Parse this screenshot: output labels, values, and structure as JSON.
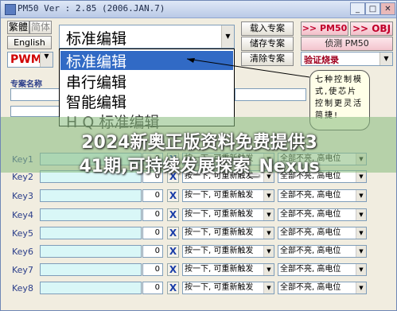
{
  "window": {
    "title": "PM50 Ver : 2.85 (2006.JAN.7)"
  },
  "titlebar": {
    "minimize": "_",
    "maximize": "□",
    "close": "✕"
  },
  "left": {
    "lang_cn1": "繁體",
    "lang_cn2": "简体",
    "lang_en": "English",
    "mode_value": "PWM"
  },
  "editor_mode": {
    "selected": "标准编辑",
    "options": [
      "标准编辑",
      "串行编辑",
      "智能编辑",
      "H Q 标准编辑"
    ]
  },
  "buttons": {
    "load": "载入专案",
    "save": "储存专案",
    "clear": "清除专案",
    "to_pm50": ">> PM50",
    "to_obj": ">> OBJ",
    "detect": "侦测 PM50",
    "verify": "验证烧录"
  },
  "labels": {
    "project_name": "专案名称"
  },
  "tooltip": {
    "text": "七种控制模式,使芯片控制更灵活简捷!"
  },
  "keys": [
    {
      "label": "Key1",
      "num": "0",
      "trigger": "按一下, 可重新触发",
      "state": "全部不亮, 高电位"
    },
    {
      "label": "Key2",
      "num": "0",
      "trigger": "按一下, 可重新触发",
      "state": "全部不亮, 高电位"
    },
    {
      "label": "Key3",
      "num": "0",
      "trigger": "按一下, 可重新触发",
      "state": "全部不亮, 高电位"
    },
    {
      "label": "Key4",
      "num": "0",
      "trigger": "按一下, 可重新触发",
      "state": "全部不亮, 高电位"
    },
    {
      "label": "Key5",
      "num": "0",
      "trigger": "按一下, 可重新触发",
      "state": "全部不亮, 高电位"
    },
    {
      "label": "Key6",
      "num": "0",
      "trigger": "按一下, 可重新触发",
      "state": "全部不亮, 高电位"
    },
    {
      "label": "Key7",
      "num": "0",
      "trigger": "按一下, 可重新触发",
      "state": "全部不亮, 高电位"
    },
    {
      "label": "Key8",
      "num": "0",
      "trigger": "按一下, 可重新触发",
      "state": "全部不亮, 高电位"
    }
  ],
  "banner": {
    "line1": "2024新奥正版资料免费提供3",
    "line2": "41期,可持续发展探索_Nexus"
  },
  "colors": {
    "selection": "#316ac5",
    "window_bg": "#f1ede0",
    "accent_red": "#c0002a"
  }
}
